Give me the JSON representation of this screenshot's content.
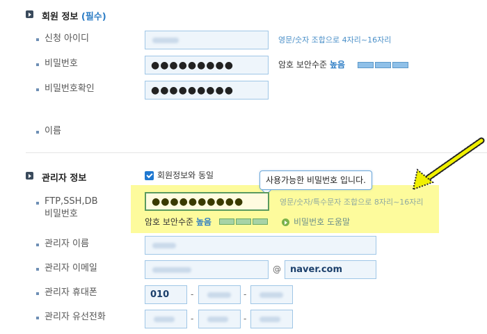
{
  "member": {
    "title": "회원 정보",
    "required": "(필수)",
    "id_label": "신청 아이디",
    "id_hint": "영문/숫자 조합으로 4자리~16자리",
    "pw_label": "비밀번호",
    "pw_value": "●●●●●●●●●",
    "pw_strength_label": "암호 보안수준",
    "pw_strength_level": "높음",
    "pw_confirm_label": "비밀번호확인",
    "pw_confirm_value": "●●●●●●●●●",
    "name_label": "이름"
  },
  "admin": {
    "title": "관리자 정보",
    "same_as_member_label": "회원정보와 동일",
    "same_as_member_checked": true,
    "ftp_label_line1": "FTP,SSH,DB",
    "ftp_label_line2": "비밀번호",
    "ftp_value": "●●●●●●●●●●",
    "tooltip": "사용가능한 비밀번호 입니다.",
    "ftp_hint": "영문/숫자/특수문자 조합으로 8자리~16자리",
    "ftp_strength_label": "암호 보안수준",
    "ftp_strength_level": "높음",
    "help_link": "비밀번호 도움말",
    "name_label": "관리자 이름",
    "email_label": "관리자 이메일",
    "email_at": "@",
    "email_domain": "naver.com",
    "mobile_label": "관리자 휴대폰",
    "mobile_prefix": "010",
    "phone_label": "관리자 유선전화",
    "dash": "-"
  },
  "colors": {
    "accent": "#2a7bc4",
    "highlight": "#fdfb9c",
    "field_bg": "#eef5fb",
    "field_border": "#9fc6e6",
    "arrow": "#f0f000"
  },
  "icons": {
    "section": "section-marker-icon",
    "checkbox": "checkbox-checked-icon",
    "help": "help-arrow-icon",
    "annotation": "yellow-arrow-icon"
  }
}
